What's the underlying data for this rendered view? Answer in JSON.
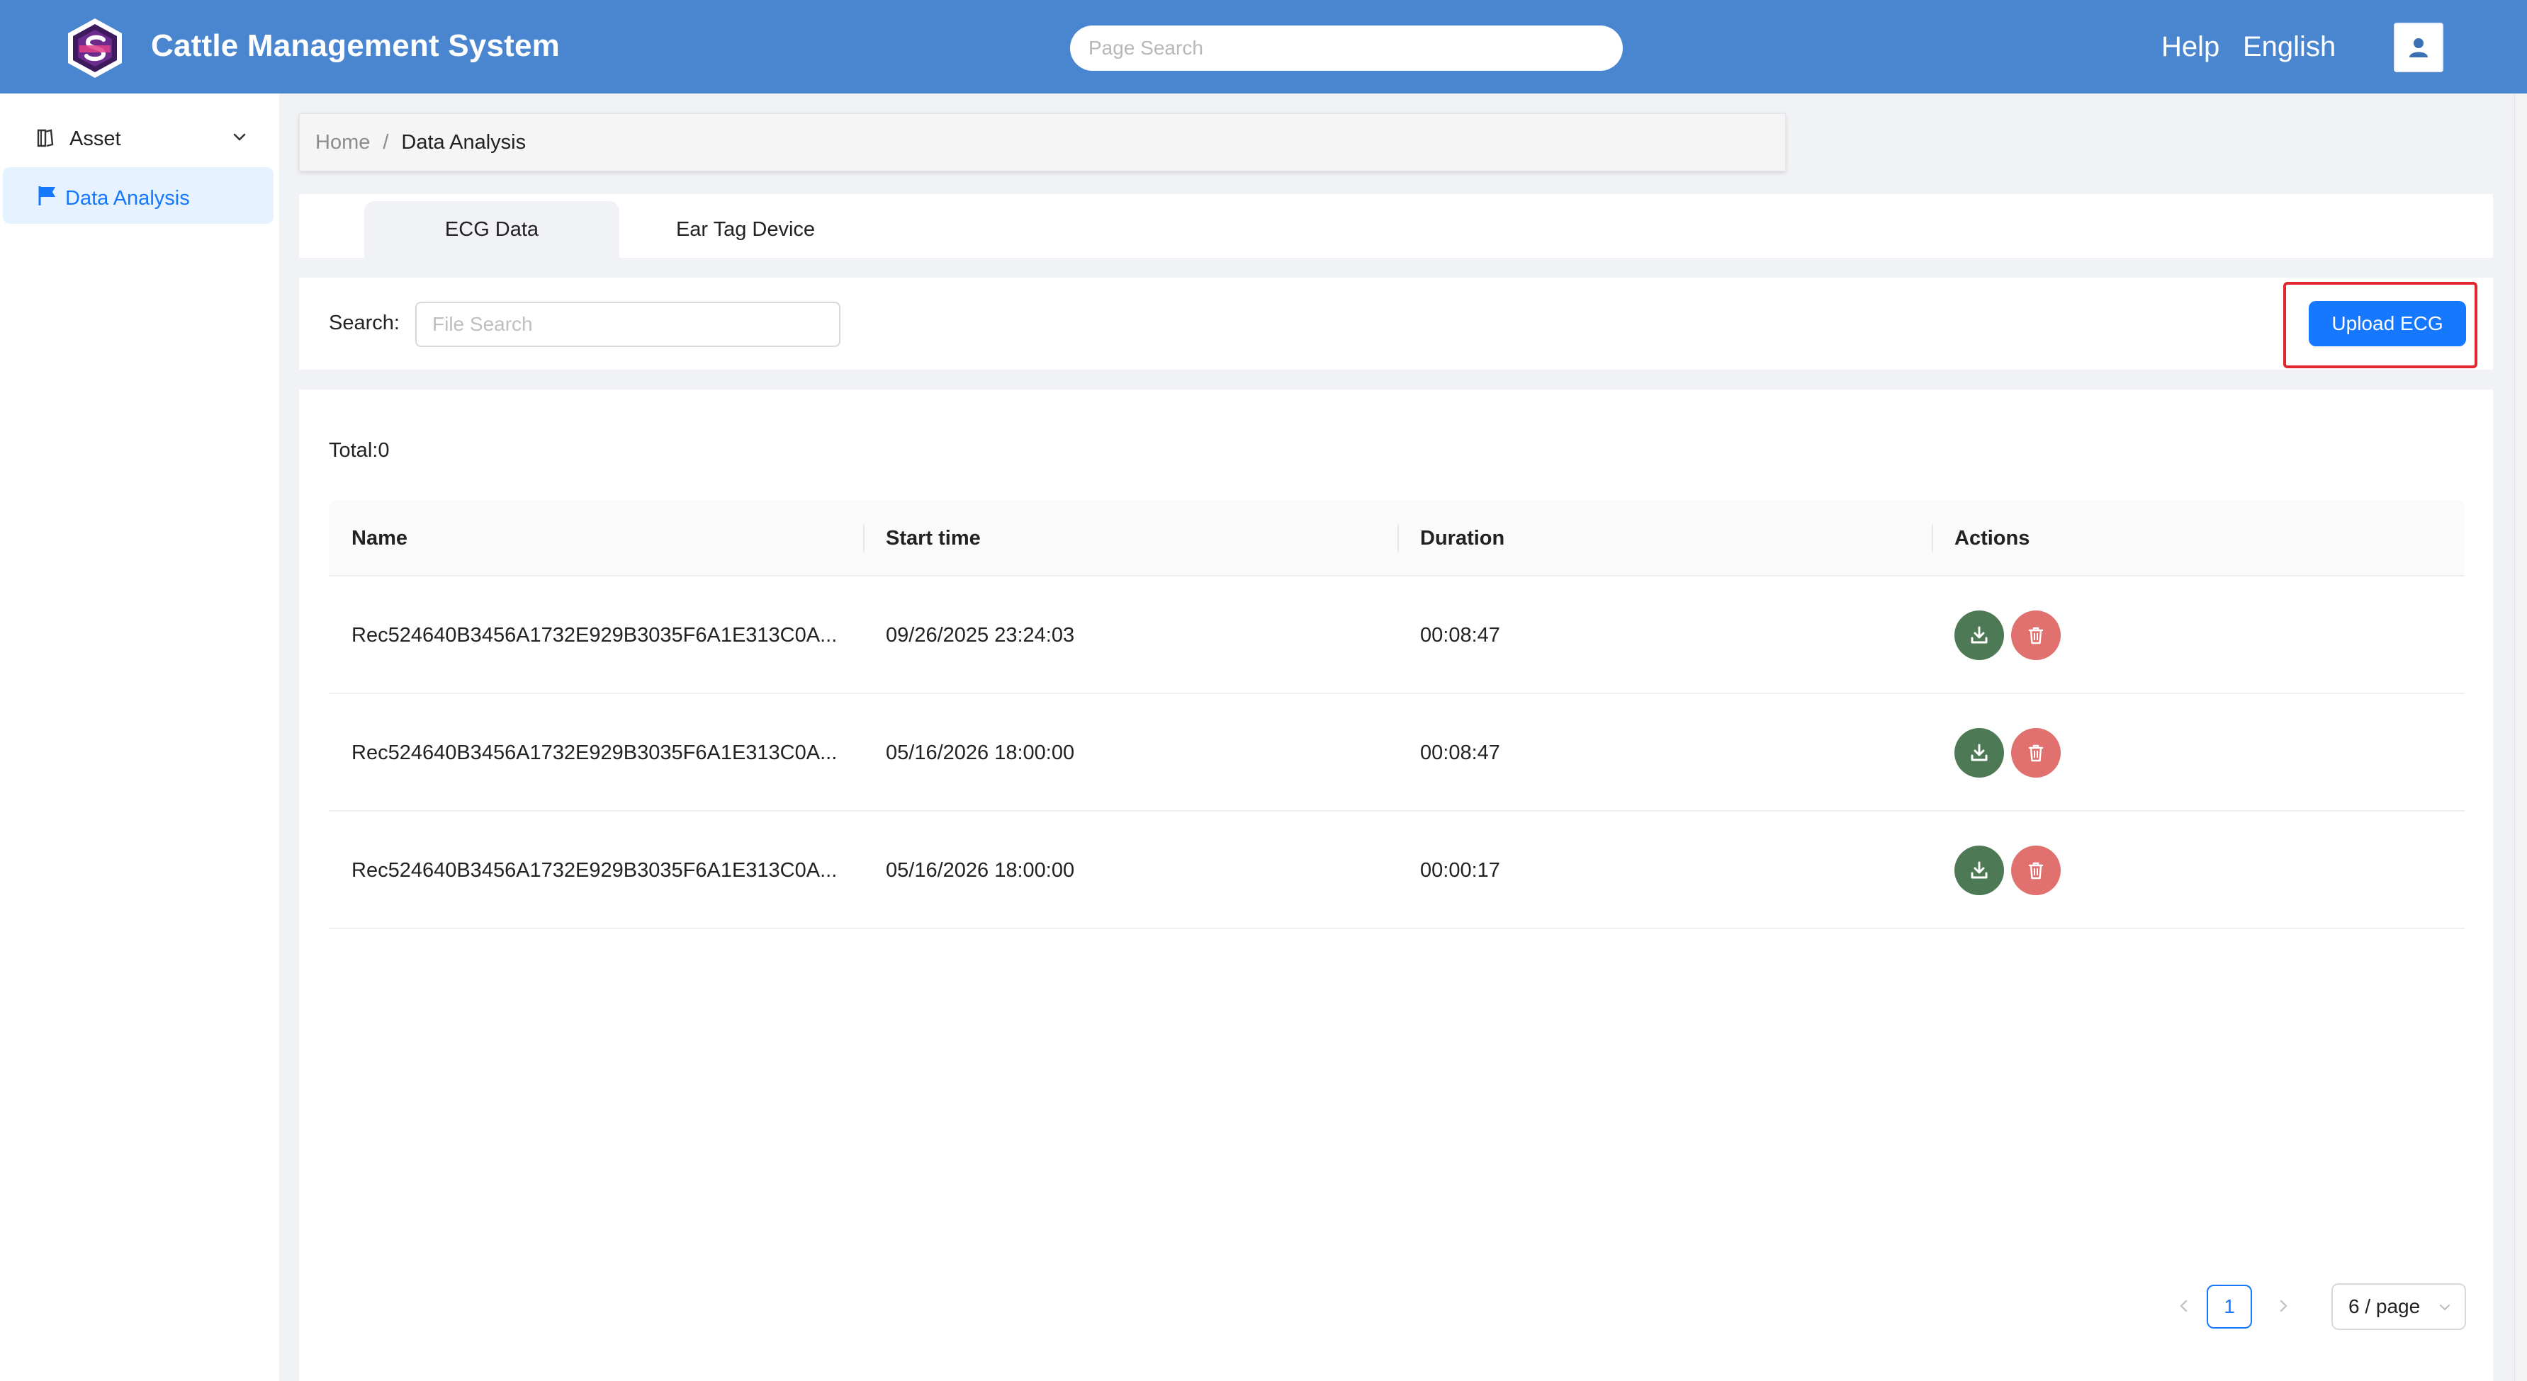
{
  "header": {
    "app_title": "Cattle Management System",
    "search_placeholder": "Page Search",
    "help_label": "Help",
    "language_label": "English",
    "bg_color": "#4a86cf"
  },
  "sidebar": {
    "items": [
      {
        "label": "Asset",
        "icon": "book-icon",
        "expandable": true
      },
      {
        "label": "Data Analysis",
        "icon": "flag-icon",
        "active": true
      }
    ]
  },
  "breadcrumb": {
    "home": "Home",
    "separator": "/",
    "current": "Data Analysis"
  },
  "tabs": [
    {
      "label": "ECG Data",
      "active": true
    },
    {
      "label": "Ear Tag Device",
      "active": false
    }
  ],
  "search": {
    "label": "Search:",
    "placeholder": "File Search",
    "upload_label": "Upload ECG"
  },
  "table": {
    "total_label": "Total:0",
    "columns": [
      "Name",
      "Start time",
      "Duration",
      "Actions"
    ],
    "rows": [
      {
        "name": "Rec524640B3456A1732E929B3035F6A1E313C0A...",
        "start_time": "09/26/2025 23:24:03",
        "duration": "00:08:47"
      },
      {
        "name": "Rec524640B3456A1732E929B3035F6A1E313C0A...",
        "start_time": "05/16/2026 18:00:00",
        "duration": "00:08:47"
      },
      {
        "name": "Rec524640B3456A1732E929B3035F6A1E313C0A...",
        "start_time": "05/16/2026 18:00:00",
        "duration": "00:00:17"
      }
    ]
  },
  "pagination": {
    "current_page": "1",
    "page_size_label": "6 / page"
  },
  "colors": {
    "primary": "#1677ff",
    "download_btn": "#4d7a55",
    "delete_btn": "#e0716e",
    "highlight": "#e0282e"
  }
}
